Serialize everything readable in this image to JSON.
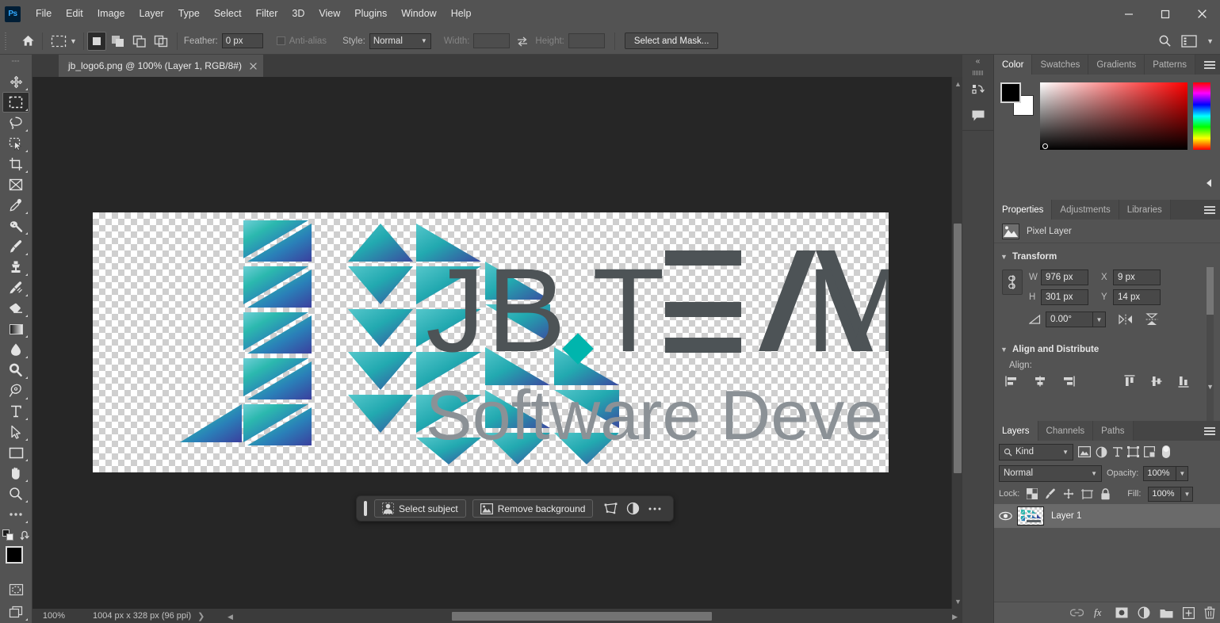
{
  "app": {
    "name": "Adobe Photoshop",
    "logo_text": "Ps"
  },
  "menubar": {
    "items": [
      "File",
      "Edit",
      "Image",
      "Layer",
      "Type",
      "Select",
      "Filter",
      "3D",
      "View",
      "Plugins",
      "Window",
      "Help"
    ]
  },
  "window_controls": {
    "minimize": "minimize-icon",
    "maximize": "maximize-icon",
    "close": "close-icon"
  },
  "options_bar": {
    "home_icon": "home-icon",
    "tool_preset": "rectangular-marquee-preset",
    "selection_modes": [
      "new-selection",
      "add-to-selection",
      "subtract-from-selection",
      "intersect-with-selection"
    ],
    "active_selection_mode": "new-selection",
    "feather_label": "Feather:",
    "feather_value": "0 px",
    "antialias_label": "Anti-alias",
    "antialias_checked": false,
    "style_label": "Style:",
    "style_value": "Normal",
    "width_label": "Width:",
    "width_value": "",
    "swap_icon": "swap-width-height-icon",
    "height_label": "Height:",
    "height_value": "",
    "select_and_mask_label": "Select and Mask...",
    "search_icon": "search-icon",
    "workspace_icon": "workspace-switcher-icon",
    "workspace_chevron": "chevron-down-icon"
  },
  "toolbar": {
    "tools": [
      {
        "name": "move-tool",
        "selected": false
      },
      {
        "name": "rectangular-marquee-tool",
        "selected": true
      },
      {
        "name": "lasso-tool",
        "selected": false
      },
      {
        "name": "object-selection-tool",
        "selected": false
      },
      {
        "name": "crop-tool",
        "selected": false
      },
      {
        "name": "frame-tool",
        "selected": false
      },
      {
        "name": "eyedropper-tool",
        "selected": false
      },
      {
        "name": "spot-healing-brush-tool",
        "selected": false
      },
      {
        "name": "brush-tool",
        "selected": false
      },
      {
        "name": "clone-stamp-tool",
        "selected": false
      },
      {
        "name": "history-brush-tool",
        "selected": false
      },
      {
        "name": "eraser-tool",
        "selected": false
      },
      {
        "name": "gradient-tool",
        "selected": false
      },
      {
        "name": "blur-tool",
        "selected": false
      },
      {
        "name": "dodge-tool",
        "selected": false
      },
      {
        "name": "pen-tool",
        "selected": false
      },
      {
        "name": "type-tool",
        "selected": false
      },
      {
        "name": "path-selection-tool",
        "selected": false
      },
      {
        "name": "rectangle-tool",
        "selected": false
      },
      {
        "name": "hand-tool",
        "selected": false
      },
      {
        "name": "zoom-tool",
        "selected": false
      },
      {
        "name": "edit-toolbar-tool",
        "selected": false
      }
    ],
    "foreground_color": "#000000",
    "background_color": "#ffffff",
    "quick_mask_name": "quick-mask-mode",
    "screen_mode_name": "screen-mode"
  },
  "document": {
    "tab_title": "jb_logo6.png @ 100% (Layer 1, RGB/8#)",
    "close_icon": "close-icon",
    "zoom": "100%",
    "dimensions": "1004 px x 328 px (96 ppi)",
    "status_chevron": "chevron-right-icon"
  },
  "artwork": {
    "wordmark_main": "JB.TEAM",
    "wordmark_sub": "Software Developer",
    "mark_colors": {
      "teal": "#29b4ab",
      "cyan": "#5fc8d0",
      "blue": "#3a4fa0",
      "mid_blue": "#2f6bb0"
    },
    "text_color": "#4d5356",
    "sub_color": "#7f868b",
    "dot_color": "#00b5ad"
  },
  "contextual_task_bar": {
    "grip_name": "drag-handle",
    "select_subject_label": "Select subject",
    "select_subject_icon": "person-select-icon",
    "remove_background_label": "Remove background",
    "remove_background_icon": "image-icon",
    "transform_icon": "transform-icon",
    "adjustment_icon": "adjustment-layer-icon",
    "more_icon": "more-options-icon"
  },
  "dock_rail": {
    "collapse_icon": "collapse-panels-icon",
    "buttons": [
      {
        "name": "history-icon"
      },
      {
        "name": "comments-icon"
      }
    ]
  },
  "color_panel": {
    "tabs": [
      {
        "label": "Color",
        "active": true
      },
      {
        "label": "Swatches",
        "active": false
      },
      {
        "label": "Gradients",
        "active": false
      },
      {
        "label": "Patterns",
        "active": false
      }
    ],
    "menu_icon": "panel-menu-icon",
    "foreground": "#000000",
    "background": "#ffffff"
  },
  "properties_panel": {
    "tabs": [
      {
        "label": "Properties",
        "active": true
      },
      {
        "label": "Adjustments",
        "active": false
      },
      {
        "label": "Libraries",
        "active": false
      }
    ],
    "menu_icon": "panel-menu-icon",
    "layer_type": "Pixel Layer",
    "layer_type_icon": "pixel-layer-icon",
    "transform": {
      "title": "Transform",
      "chevron": "chevron-down-icon",
      "link_icon": "link-width-height-icon",
      "w_label": "W",
      "w_value": "976 px",
      "h_label": "H",
      "h_value": "301 px",
      "x_label": "X",
      "x_value": "9 px",
      "y_label": "Y",
      "y_value": "14 px",
      "angle_icon": "angle-icon",
      "angle_value": "0.00°",
      "angle_chevron": "chevron-down-icon",
      "flip_horizontal_icon": "flip-horizontal-icon",
      "flip_vertical_icon": "flip-vertical-icon"
    },
    "align": {
      "title": "Align and Distribute",
      "chevron": "chevron-down-icon",
      "label": "Align:",
      "icons": [
        "align-left-edges-icon",
        "align-horizontal-centers-icon",
        "align-right-edges-icon",
        "align-top-edges-icon",
        "align-vertical-centers-icon",
        "align-bottom-edges-icon"
      ],
      "more_chevron": "chevron-down-icon"
    }
  },
  "layers_panel": {
    "tabs": [
      {
        "label": "Layers",
        "active": true
      },
      {
        "label": "Channels",
        "active": false
      },
      {
        "label": "Paths",
        "active": false
      }
    ],
    "menu_icon": "panel-menu-icon",
    "filter": {
      "search_icon": "search-icon",
      "kind_label": "Kind",
      "chevron": "chevron-down-icon",
      "filter_icons": [
        "filter-pixel-icon",
        "filter-adjustment-icon",
        "filter-type-icon",
        "filter-shape-icon",
        "filter-smart-object-icon"
      ],
      "toggle_name": "filter-toggle"
    },
    "blend_mode": "Normal",
    "blend_chevron": "chevron-down-icon",
    "opacity_label": "Opacity:",
    "opacity_value": "100%",
    "lock_label": "Lock:",
    "lock_icons": [
      "lock-transparent-pixels-icon",
      "lock-image-pixels-icon",
      "lock-position-icon",
      "lock-artboard-nesting-icon",
      "lock-all-icon"
    ],
    "fill_label": "Fill:",
    "fill_value": "100%",
    "layers": [
      {
        "name": "Layer 1",
        "visible": true,
        "selected": true,
        "visibility_icon": "eye-icon"
      }
    ],
    "footer_icons": [
      "link-layers-icon",
      "layer-style-fx-icon",
      "add-layer-mask-icon",
      "new-adjustment-layer-icon",
      "new-group-icon",
      "new-layer-icon",
      "delete-layer-icon"
    ]
  },
  "scrollbars": {
    "vertical_name": "canvas-vertical-scrollbar",
    "horizontal_name": "canvas-horizontal-scrollbar",
    "up_arrow": "chevron-up-icon",
    "down_arrow": "chevron-down-icon",
    "left_arrow": "chevron-left-icon",
    "right_arrow": "chevron-right-icon"
  }
}
